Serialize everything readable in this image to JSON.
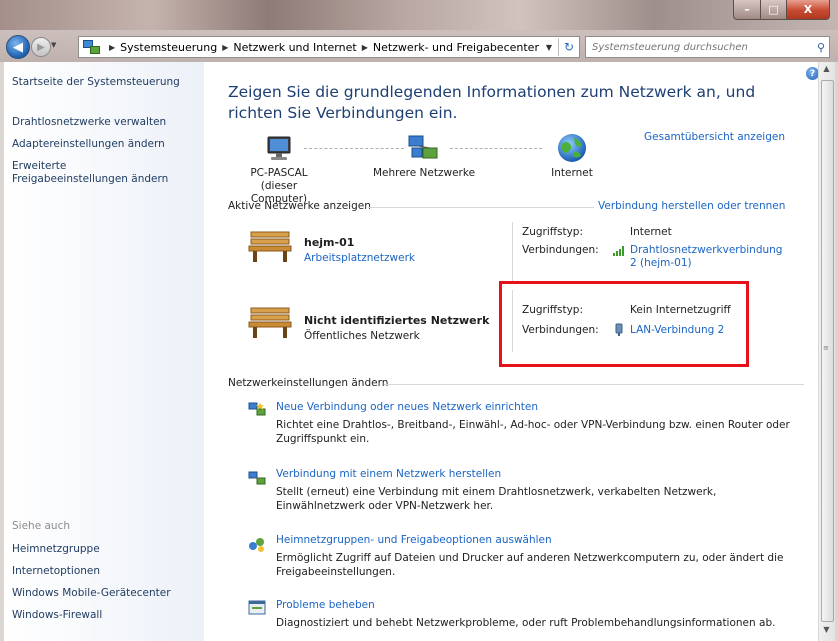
{
  "titlebar": {
    "min": "–",
    "max": "□",
    "close": "X"
  },
  "address": {
    "crumbs": [
      "Systemsteuerung",
      "Netzwerk und Internet",
      "Netzwerk- und Freigabecenter"
    ],
    "search_placeholder": "Systemsteuerung durchsuchen"
  },
  "sidebar": {
    "items": [
      "Startseite der Systemsteuerung",
      "Drahtlosnetzwerke verwalten",
      "Adaptereinstellungen ändern",
      "Erweiterte\nFreigabeeinstellungen ändern"
    ],
    "seealso_label": "Siehe auch",
    "seealso": [
      "Heimnetzgruppe",
      "Internetoptionen",
      "Windows Mobile-Gerätecenter",
      "Windows-Firewall"
    ]
  },
  "main": {
    "heading": "Zeigen Sie die grundlegenden Informationen zum Netzwerk an, und richten Sie Verbindungen ein.",
    "overview_link": "Gesamtübersicht anzeigen",
    "nodes": [
      {
        "label": "PC-PASCAL",
        "sub": "(dieser Computer)"
      },
      {
        "label": "Mehrere Netzwerke",
        "sub": ""
      },
      {
        "label": "Internet",
        "sub": ""
      }
    ],
    "active_title": "Aktive Netzwerke anzeigen",
    "connect_link": "Verbindung herstellen oder trennen",
    "networks": [
      {
        "name": "hejm-01",
        "type": "Arbeitsplatznetzwerk",
        "access_label": "Zugriffstyp:",
        "access": "Internet",
        "conn_label": "Verbindungen:",
        "conn": "Drahtlosnetzwerkverbindung 2 (hejm-01)"
      },
      {
        "name": "Nicht identifiziertes Netzwerk",
        "type": "Öffentliches Netzwerk",
        "access_label": "Zugriffstyp:",
        "access": "Kein Internetzugriff",
        "conn_label": "Verbindungen:",
        "conn": "LAN-Verbindung 2"
      }
    ],
    "settings_title": "Netzwerkeinstellungen ändern",
    "tasks": [
      {
        "title": "Neue Verbindung oder neues Netzwerk einrichten",
        "desc": "Richtet eine Drahtlos-, Breitband-, Einwähl-, Ad-hoc- oder VPN-Verbindung bzw. einen Router oder Zugriffspunkt ein."
      },
      {
        "title": "Verbindung mit einem Netzwerk herstellen",
        "desc": "Stellt (erneut) eine Verbindung mit einem Drahtlosnetzwerk, verkabelten Netzwerk, Einwählnetzwerk oder VPN-Netzwerk her."
      },
      {
        "title": "Heimnetzgruppen- und Freigabeoptionen auswählen",
        "desc": "Ermöglicht Zugriff auf Dateien und Drucker auf anderen Netzwerkcomputern zu, oder ändert die Freigabeeinstellungen."
      },
      {
        "title": "Probleme beheben",
        "desc": "Diagnostiziert und behebt Netzwerkprobleme, oder ruft Problembehandlungsinformationen ab."
      }
    ]
  },
  "colors": {
    "link": "#1a64c4",
    "heading": "#1e3f73",
    "highlight": "#e5121b"
  }
}
